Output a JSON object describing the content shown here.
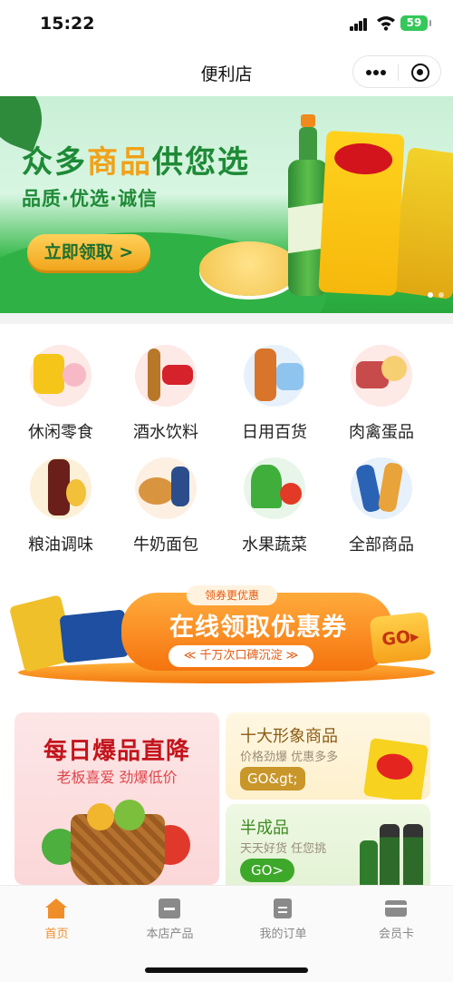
{
  "status_bar": {
    "time": "15:22",
    "battery": "59"
  },
  "nav": {
    "title": "便利店"
  },
  "banner": {
    "headline_part1": "众多",
    "headline_part2": "商品",
    "headline_part3": "供您选",
    "subline": "品质·优选·诚信",
    "cta": "立即领取 >",
    "slide_count": 2,
    "active_slide": 1
  },
  "categories": [
    {
      "label": "休闲零食",
      "icon": "snacks-image"
    },
    {
      "label": "酒水饮料",
      "icon": "drinks-image"
    },
    {
      "label": "日用百货",
      "icon": "daily-goods-image"
    },
    {
      "label": "肉禽蛋品",
      "icon": "meat-eggs-image"
    },
    {
      "label": "粮油调味",
      "icon": "grain-oil-image"
    },
    {
      "label": "牛奶面包",
      "icon": "milk-bread-image"
    },
    {
      "label": "水果蔬菜",
      "icon": "fruit-veg-image"
    },
    {
      "label": "全部商品",
      "icon": "all-goods-image"
    }
  ],
  "coupon": {
    "pill": "领券更优惠",
    "title": "在线领取优惠券",
    "tag": "≪ 千万次口碑沉淀 ≫",
    "go": "GO▸"
  },
  "promos": {
    "daily": {
      "title": "每日爆品直降",
      "subtitle": "老板喜爱 劲爆低价"
    },
    "top_ten": {
      "title": "十大形象商品",
      "subtitle": "价格劲爆 优惠多多",
      "button": "GO&gt;"
    },
    "semi": {
      "title": "半成品",
      "subtitle": "天天好货 任您挑",
      "button": "GO>"
    }
  },
  "tabs": [
    {
      "label": "首页",
      "active": true
    },
    {
      "label": "本店产品",
      "active": false
    },
    {
      "label": "我的订单",
      "active": false
    },
    {
      "label": "会员卡",
      "active": false
    }
  ],
  "colors": {
    "accent": "#f08f2a",
    "brand_green": "#1e8a36",
    "coupon_orange": "#f5740f",
    "promo_red": "#c3141c"
  }
}
